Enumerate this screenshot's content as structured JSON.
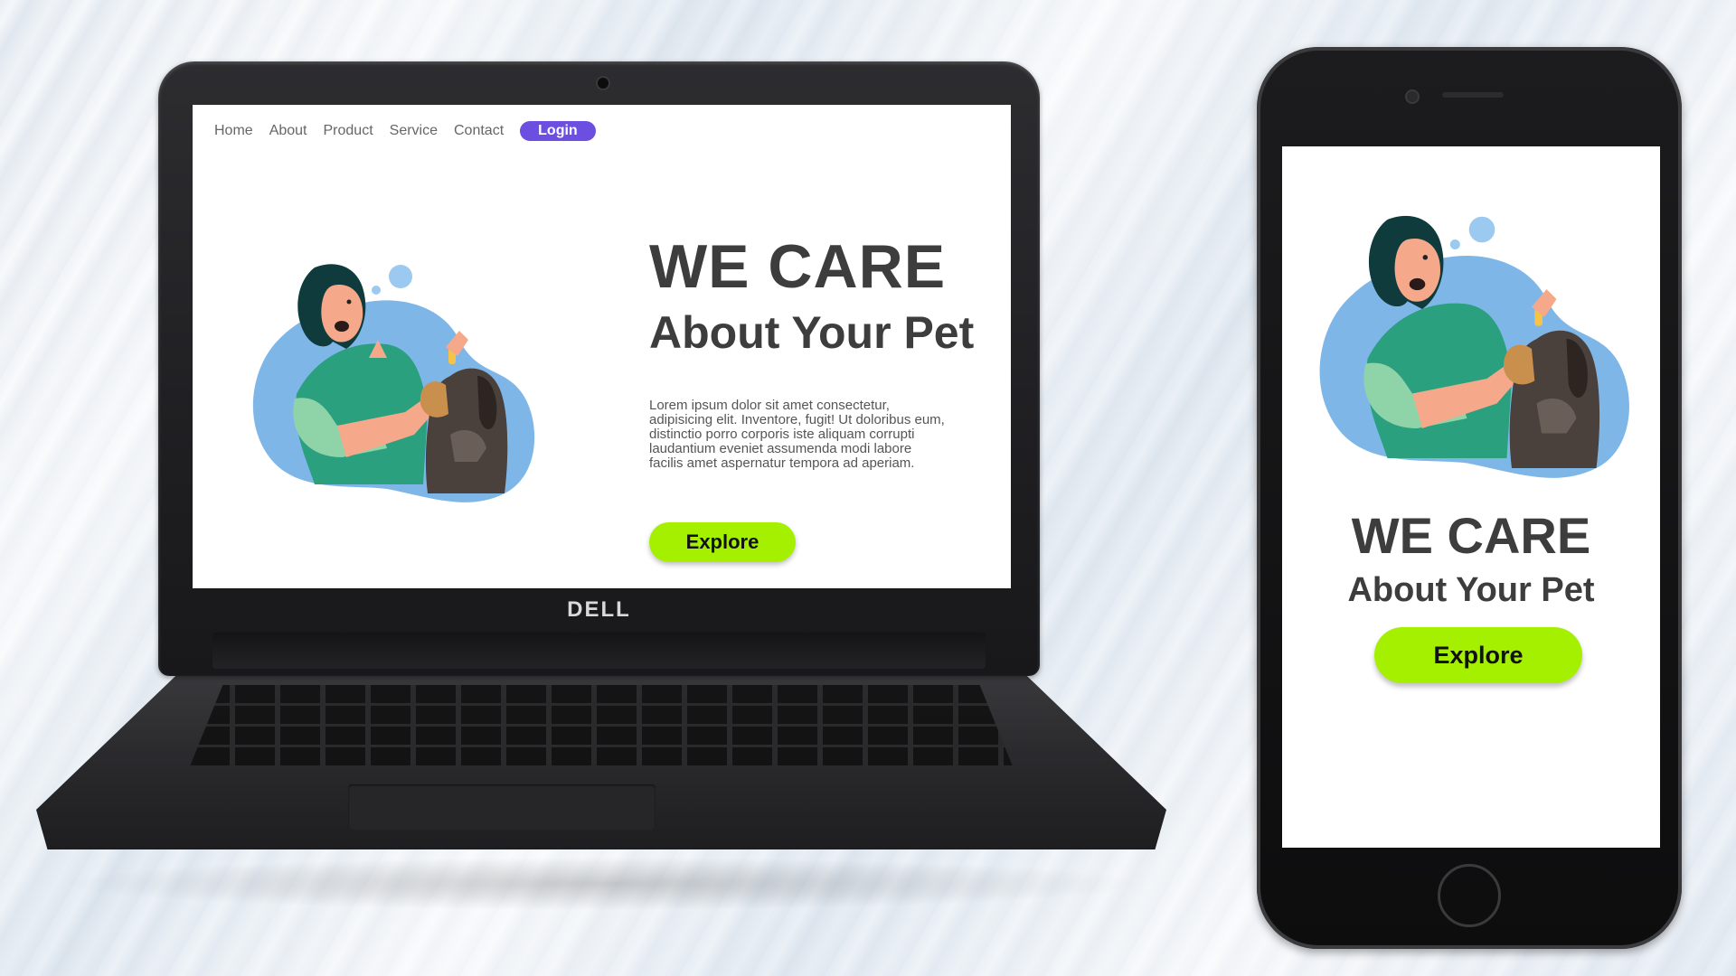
{
  "laptop": {
    "brand": "DELL",
    "site": {
      "nav": {
        "links": [
          "Home",
          "About",
          "Product",
          "Service",
          "Contact"
        ],
        "login_label": "Login"
      },
      "hero": {
        "title": "WE CARE",
        "subtitle": "About Your Pet",
        "body": "Lorem ipsum dolor sit amet consectetur, adipisicing elit. Inventore, fugit! Ut doloribus eum, distinctio porro corporis iste aliquam corrupti laudantium eveniet assumenda modi labore facilis amet aspernatur tempora ad aperiam.",
        "cta": "Explore"
      }
    }
  },
  "phone": {
    "site": {
      "hero": {
        "title": "WE CARE",
        "subtitle": "About Your Pet",
        "cta": "Explore"
      }
    }
  },
  "colors": {
    "accent_cta": "#a4f000",
    "login_button": "#6c4ee0",
    "heading": "#3d3d3d",
    "blob_blue": "#7fb6e8",
    "shirt_green": "#2aa07f"
  },
  "icons": [
    "webcam-icon",
    "front-camera-icon",
    "home-button-icon",
    "woman-with-dog-illustration"
  ]
}
